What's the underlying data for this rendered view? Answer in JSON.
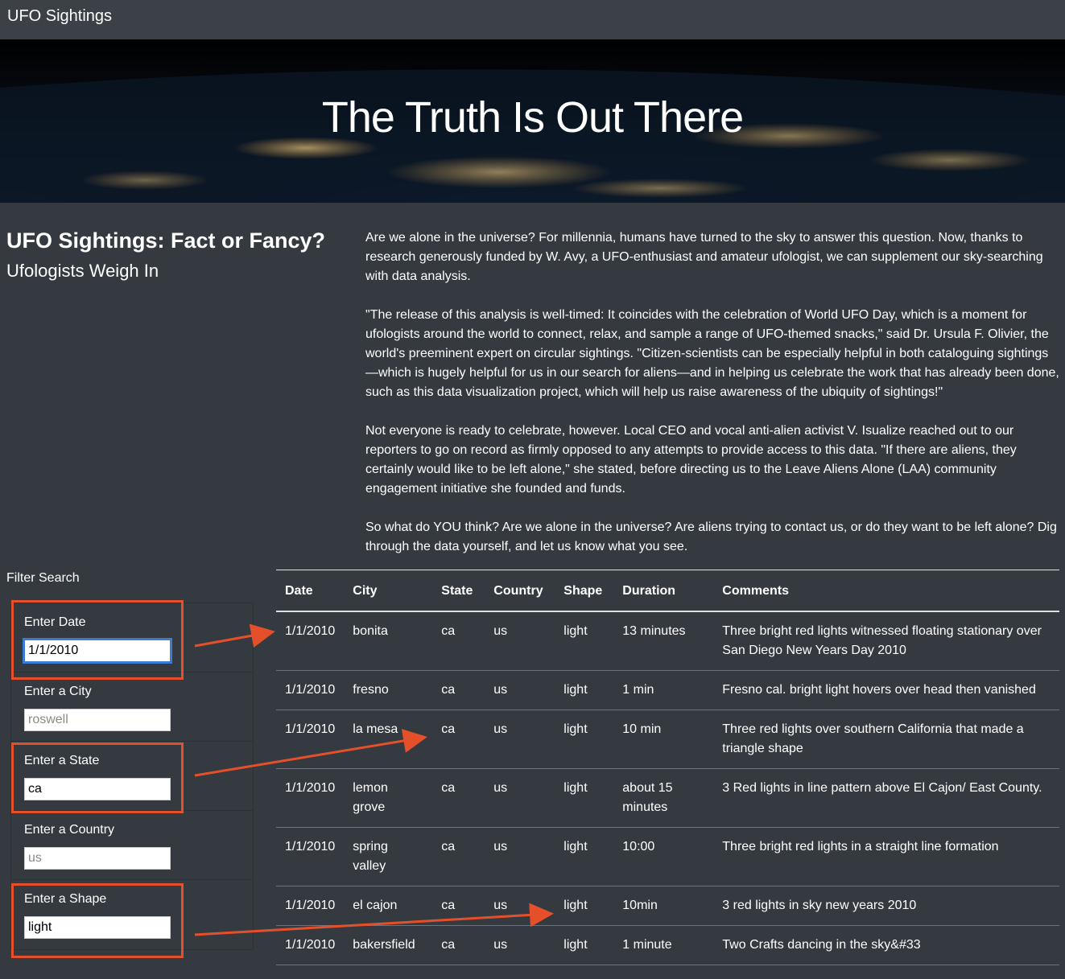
{
  "navbar": {
    "brand": "UFO Sightings"
  },
  "hero": {
    "title": "The Truth Is Out There"
  },
  "intro": {
    "heading": "UFO Sightings: Fact or Fancy?",
    "subheading": "Ufologists Weigh In",
    "paragraphs": [
      "Are we alone in the universe? For millennia, humans have turned to the sky to answer this question. Now, thanks to research generously funded by W. Avy, a UFO-enthusiast and amateur ufologist, we can supplement our sky-searching with data analysis.",
      "\"The release of this analysis is well-timed: It coincides with the celebration of World UFO Day, which is a moment for ufologists around the world to connect, relax, and sample a range of UFO-themed snacks,\" said Dr. Ursula F. Olivier, the world's preeminent expert on circular sightings. \"Citizen-scientists can be especially helpful in both cataloguing sightings—which is hugely helpful for us in our search for aliens—and in helping us celebrate the work that has already been done, such as this data visualization project, which will help us raise awareness of the ubiquity of sightings!\"",
      "Not everyone is ready to celebrate, however. Local CEO and vocal anti-alien activist V. Isualize reached out to our reporters to go on record as firmly opposed to any attempts to provide access to this data. \"If there are aliens, they certainly would like to be left alone,\" she stated, before directing us to the Leave Aliens Alone (LAA) community engagement initiative she founded and funds.",
      "So what do YOU think? Are we alone in the universe? Are aliens trying to contact us, or do they want to be left alone? Dig through the data yourself, and let us know what you see."
    ]
  },
  "filters": {
    "title": "Filter Search",
    "items": [
      {
        "label": "Enter Date",
        "value": "1/1/2010",
        "placeholder": ""
      },
      {
        "label": "Enter a City",
        "value": "",
        "placeholder": "roswell"
      },
      {
        "label": "Enter a State",
        "value": "ca",
        "placeholder": ""
      },
      {
        "label": "Enter a Country",
        "value": "",
        "placeholder": "us"
      },
      {
        "label": "Enter a Shape",
        "value": "light",
        "placeholder": ""
      }
    ]
  },
  "table": {
    "headers": [
      "Date",
      "City",
      "State",
      "Country",
      "Shape",
      "Duration",
      "Comments"
    ],
    "rows": [
      [
        "1/1/2010",
        "bonita",
        "ca",
        "us",
        "light",
        "13 minutes",
        "Three bright red lights witnessed floating stationary over San Diego New Years Day 2010"
      ],
      [
        "1/1/2010",
        "fresno",
        "ca",
        "us",
        "light",
        "1 min",
        "Fresno cal. bright light hovers over head then vanished"
      ],
      [
        "1/1/2010",
        "la mesa",
        "ca",
        "us",
        "light",
        "10 min",
        "Three red lights over southern California that made a triangle shape"
      ],
      [
        "1/1/2010",
        "lemon grove",
        "ca",
        "us",
        "light",
        "about 15 minutes",
        "3 Red lights in line pattern above El Cajon/ East County."
      ],
      [
        "1/1/2010",
        "spring valley",
        "ca",
        "us",
        "light",
        "10:00",
        "Three bright red lights in a straight line formation"
      ],
      [
        "1/1/2010",
        "el cajon",
        "ca",
        "us",
        "light",
        "10min",
        "3 red lights in sky new years 2010"
      ],
      [
        "1/1/2010",
        "bakersfield",
        "ca",
        "us",
        "light",
        "1 minute",
        "Two Crafts dancing in the sky&#33"
      ]
    ]
  },
  "colors": {
    "background": "#343a40",
    "navbar": "#3c4147",
    "annotation": "#e5502b"
  }
}
